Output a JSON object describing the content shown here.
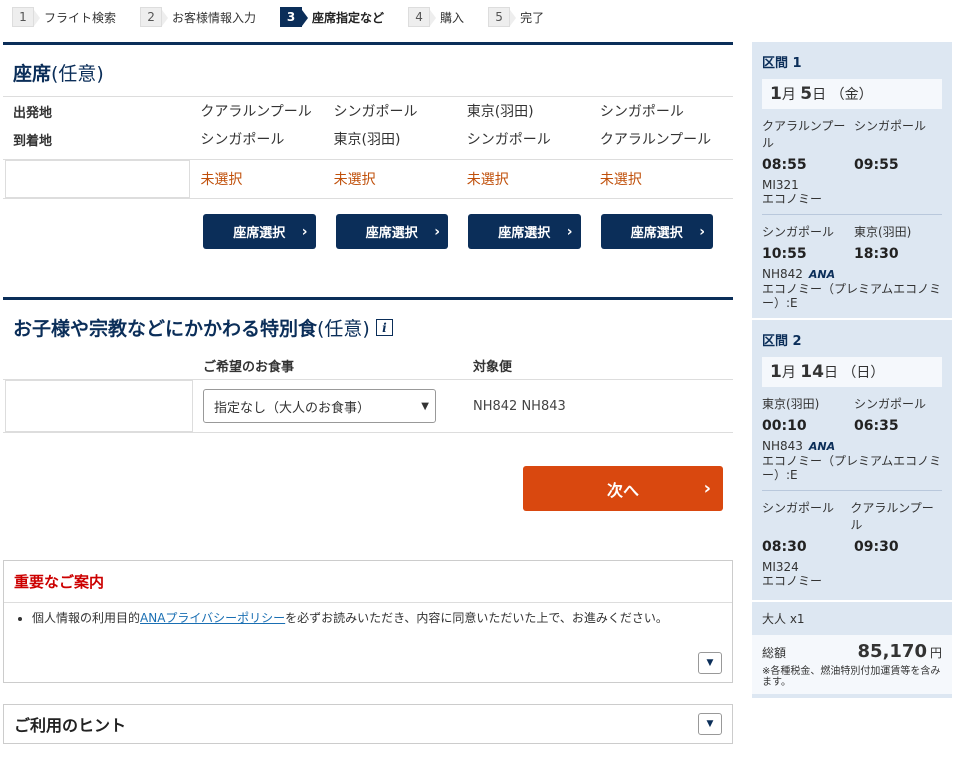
{
  "steps": [
    {
      "num": "1",
      "label": "フライト検索"
    },
    {
      "num": "2",
      "label": "お客様情報入力"
    },
    {
      "num": "3",
      "label": "座席指定など"
    },
    {
      "num": "4",
      "label": "購入"
    },
    {
      "num": "5",
      "label": "完了"
    }
  ],
  "seat": {
    "title": "座席",
    "optional": "(任意)",
    "departure_label": "出発地",
    "arrival_label": "到着地",
    "departures": [
      "クアラルンプール",
      "シンガポール",
      "東京(羽田)",
      "シンガポール"
    ],
    "arrivals": [
      "シンガポール",
      "東京(羽田)",
      "シンガポール",
      "クアラルンプール"
    ],
    "status": [
      "未選択",
      "未選択",
      "未選択",
      "未選択"
    ],
    "button_label": "座席選択"
  },
  "meal": {
    "title": "お子様や宗教などにかかわる特別食",
    "optional": "(任意)",
    "col_meal": "ご希望のお食事",
    "col_flight": "対象便",
    "selected": "指定なし（大人のお食事）",
    "flights": "NH842 NH843"
  },
  "next_label": "次へ",
  "notice": {
    "title": "重要なご案内",
    "text_pre": "個人情報の利用目的",
    "link": "ANAプライバシーポリシー",
    "text_post": "を必ずお読みいただき、内容に同意いただいた上で、お進みください。"
  },
  "hint_title": "ご利用のヒント",
  "sidebar": {
    "segments": [
      {
        "title": "区間 1",
        "month": "1",
        "day": "5",
        "weekday": "（金）",
        "flights": [
          {
            "from": "クアラルンプール",
            "to": "シンガポール",
            "dep": "08:55",
            "arr": "09:55",
            "code": "MI321",
            "ana": "",
            "cabin": "エコノミー"
          },
          {
            "from": "シンガポール",
            "to": "東京(羽田)",
            "dep": "10:55",
            "arr": "18:30",
            "code": "NH842",
            "ana": "ANA",
            "cabin": "エコノミー（プレミアムエコノミー）:E"
          }
        ]
      },
      {
        "title": "区間 2",
        "month": "1",
        "day": "14",
        "weekday": "（日）",
        "flights": [
          {
            "from": "東京(羽田)",
            "to": "シンガポール",
            "dep": "00:10",
            "arr": "06:35",
            "code": "NH843",
            "ana": "ANA",
            "cabin": "エコノミー（プレミアムエコノミー）:E"
          },
          {
            "from": "シンガポール",
            "to": "クアラルンプール",
            "dep": "08:30",
            "arr": "09:30",
            "code": "MI324",
            "ana": "",
            "cabin": "エコノミー"
          }
        ]
      }
    ],
    "adult": "大人 x1",
    "total_label": "総額",
    "total_amount": "85,170",
    "currency": "円",
    "note": "※各種税金、燃油特別付加運賃等を含みます。"
  }
}
